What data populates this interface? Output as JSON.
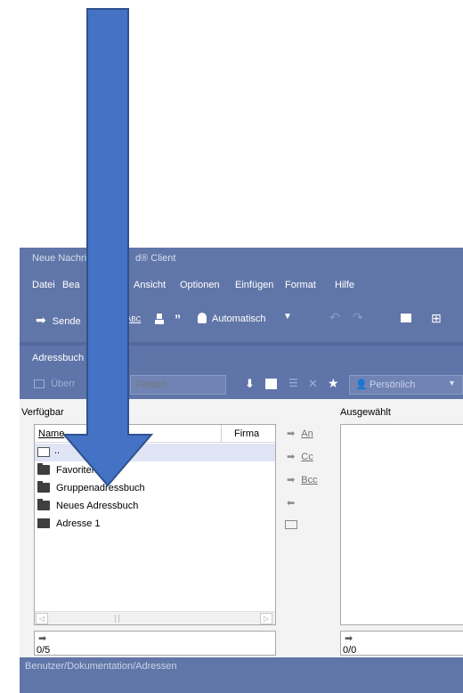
{
  "window": {
    "title": "Neue Nachri",
    "title_tail": "d® Client"
  },
  "menu": {
    "file": "Datei",
    "edit": "Bea",
    "view": "Ansicht",
    "options": "Optionen",
    "insert": "Einfügen",
    "format": "Format",
    "help": "Hilfe"
  },
  "toolbar": {
    "send": "Sende",
    "spell": "ABC",
    "mode": "Automatisch"
  },
  "addressbook": {
    "header": "Adressbuch",
    "take_over": "Überr",
    "find_placeholder": "Finden",
    "scope": "Persönlich"
  },
  "available": {
    "label": "Verfügbar",
    "columns": [
      "Name",
      "Firma"
    ],
    "rows": [
      "..",
      "Favoriten",
      "Gruppenadressbuch",
      "Neues Adressbuch",
      "Adresse 1"
    ],
    "count": "0/5"
  },
  "recipients": {
    "to": "An",
    "cc": "Cc",
    "bcc": "Bcc"
  },
  "selected": {
    "label": "Ausgewählt",
    "count": "0/0"
  },
  "status": {
    "path": "Benutzer/Dokumentation/Adressen"
  },
  "colors": {
    "chrome": "#6176a8",
    "overlay_arrow": "#4472c4"
  }
}
